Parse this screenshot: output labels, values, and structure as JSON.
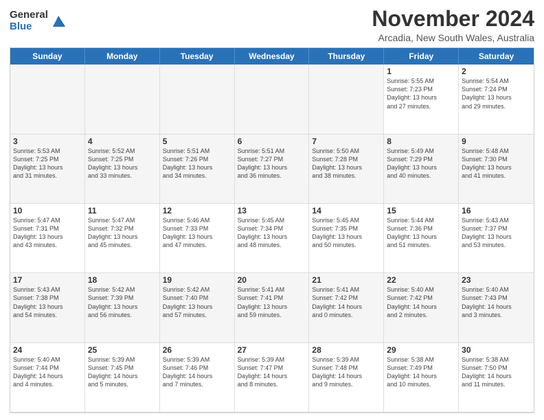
{
  "logo": {
    "general": "General",
    "blue": "Blue"
  },
  "header": {
    "title": "November 2024",
    "subtitle": "Arcadia, New South Wales, Australia"
  },
  "weekdays": [
    "Sunday",
    "Monday",
    "Tuesday",
    "Wednesday",
    "Thursday",
    "Friday",
    "Saturday"
  ],
  "weeks": [
    [
      {
        "day": "",
        "info": "",
        "empty": true
      },
      {
        "day": "",
        "info": "",
        "empty": true
      },
      {
        "day": "",
        "info": "",
        "empty": true
      },
      {
        "day": "",
        "info": "",
        "empty": true
      },
      {
        "day": "",
        "info": "",
        "empty": true
      },
      {
        "day": "1",
        "info": "Sunrise: 5:55 AM\nSunset: 7:23 PM\nDaylight: 13 hours\nand 27 minutes."
      },
      {
        "day": "2",
        "info": "Sunrise: 5:54 AM\nSunset: 7:24 PM\nDaylight: 13 hours\nand 29 minutes."
      }
    ],
    [
      {
        "day": "3",
        "info": "Sunrise: 5:53 AM\nSunset: 7:25 PM\nDaylight: 13 hours\nand 31 minutes."
      },
      {
        "day": "4",
        "info": "Sunrise: 5:52 AM\nSunset: 7:25 PM\nDaylight: 13 hours\nand 33 minutes."
      },
      {
        "day": "5",
        "info": "Sunrise: 5:51 AM\nSunset: 7:26 PM\nDaylight: 13 hours\nand 34 minutes."
      },
      {
        "day": "6",
        "info": "Sunrise: 5:51 AM\nSunset: 7:27 PM\nDaylight: 13 hours\nand 36 minutes."
      },
      {
        "day": "7",
        "info": "Sunrise: 5:50 AM\nSunset: 7:28 PM\nDaylight: 13 hours\nand 38 minutes."
      },
      {
        "day": "8",
        "info": "Sunrise: 5:49 AM\nSunset: 7:29 PM\nDaylight: 13 hours\nand 40 minutes."
      },
      {
        "day": "9",
        "info": "Sunrise: 5:48 AM\nSunset: 7:30 PM\nDaylight: 13 hours\nand 41 minutes."
      }
    ],
    [
      {
        "day": "10",
        "info": "Sunrise: 5:47 AM\nSunset: 7:31 PM\nDaylight: 13 hours\nand 43 minutes."
      },
      {
        "day": "11",
        "info": "Sunrise: 5:47 AM\nSunset: 7:32 PM\nDaylight: 13 hours\nand 45 minutes."
      },
      {
        "day": "12",
        "info": "Sunrise: 5:46 AM\nSunset: 7:33 PM\nDaylight: 13 hours\nand 47 minutes."
      },
      {
        "day": "13",
        "info": "Sunrise: 5:45 AM\nSunset: 7:34 PM\nDaylight: 13 hours\nand 48 minutes."
      },
      {
        "day": "14",
        "info": "Sunrise: 5:45 AM\nSunset: 7:35 PM\nDaylight: 13 hours\nand 50 minutes."
      },
      {
        "day": "15",
        "info": "Sunrise: 5:44 AM\nSunset: 7:36 PM\nDaylight: 13 hours\nand 51 minutes."
      },
      {
        "day": "16",
        "info": "Sunrise: 5:43 AM\nSunset: 7:37 PM\nDaylight: 13 hours\nand 53 minutes."
      }
    ],
    [
      {
        "day": "17",
        "info": "Sunrise: 5:43 AM\nSunset: 7:38 PM\nDaylight: 13 hours\nand 54 minutes."
      },
      {
        "day": "18",
        "info": "Sunrise: 5:42 AM\nSunset: 7:39 PM\nDaylight: 13 hours\nand 56 minutes."
      },
      {
        "day": "19",
        "info": "Sunrise: 5:42 AM\nSunset: 7:40 PM\nDaylight: 13 hours\nand 57 minutes."
      },
      {
        "day": "20",
        "info": "Sunrise: 5:41 AM\nSunset: 7:41 PM\nDaylight: 13 hours\nand 59 minutes."
      },
      {
        "day": "21",
        "info": "Sunrise: 5:41 AM\nSunset: 7:42 PM\nDaylight: 14 hours\nand 0 minutes."
      },
      {
        "day": "22",
        "info": "Sunrise: 5:40 AM\nSunset: 7:42 PM\nDaylight: 14 hours\nand 2 minutes."
      },
      {
        "day": "23",
        "info": "Sunrise: 5:40 AM\nSunset: 7:43 PM\nDaylight: 14 hours\nand 3 minutes."
      }
    ],
    [
      {
        "day": "24",
        "info": "Sunrise: 5:40 AM\nSunset: 7:44 PM\nDaylight: 14 hours\nand 4 minutes."
      },
      {
        "day": "25",
        "info": "Sunrise: 5:39 AM\nSunset: 7:45 PM\nDaylight: 14 hours\nand 5 minutes."
      },
      {
        "day": "26",
        "info": "Sunrise: 5:39 AM\nSunset: 7:46 PM\nDaylight: 14 hours\nand 7 minutes."
      },
      {
        "day": "27",
        "info": "Sunrise: 5:39 AM\nSunset: 7:47 PM\nDaylight: 14 hours\nand 8 minutes."
      },
      {
        "day": "28",
        "info": "Sunrise: 5:39 AM\nSunset: 7:48 PM\nDaylight: 14 hours\nand 9 minutes."
      },
      {
        "day": "29",
        "info": "Sunrise: 5:38 AM\nSunset: 7:49 PM\nDaylight: 14 hours\nand 10 minutes."
      },
      {
        "day": "30",
        "info": "Sunrise: 5:38 AM\nSunset: 7:50 PM\nDaylight: 14 hours\nand 11 minutes."
      }
    ]
  ]
}
